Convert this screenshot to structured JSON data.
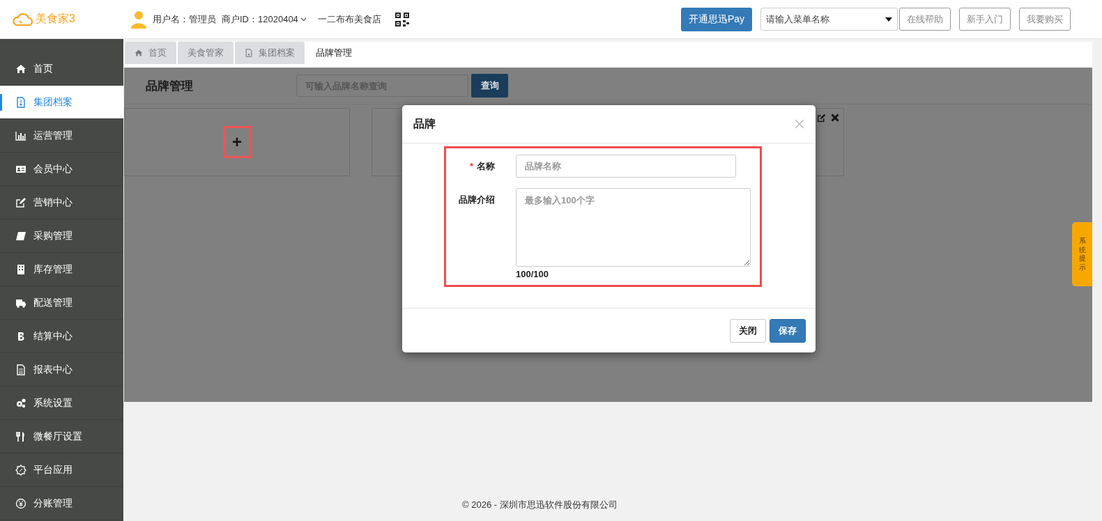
{
  "header": {
    "logo_text": "美食家3",
    "user": "用户名：管理员",
    "merchant": "商户ID：12020404",
    "store": "一二布布美食店",
    "pay_button": "开通思迅Pay",
    "menu_search": {
      "placeholder": "请输入菜单名称"
    },
    "buttons": [
      "在线帮助",
      "新手入门",
      "我要购买"
    ]
  },
  "sidebar": {
    "items": [
      {
        "label": "首页",
        "selected": false
      },
      {
        "label": "集团档案",
        "selected": true
      },
      {
        "label": "运营管理",
        "selected": false
      },
      {
        "label": "会员中心",
        "selected": false
      },
      {
        "label": "营销中心",
        "selected": false
      },
      {
        "label": "采购管理",
        "selected": false
      },
      {
        "label": "库存管理",
        "selected": false
      },
      {
        "label": "配送管理",
        "selected": false
      },
      {
        "label": "结算中心",
        "selected": false
      },
      {
        "label": "报表中心",
        "selected": false
      },
      {
        "label": "系统设置",
        "selected": false
      },
      {
        "label": "微餐厅设置",
        "selected": false
      },
      {
        "label": "平台应用",
        "selected": false
      },
      {
        "label": "分账管理",
        "selected": false
      }
    ]
  },
  "tabs": [
    {
      "label": "首页",
      "selected": false
    },
    {
      "label": "美食管家",
      "selected": false
    },
    {
      "label": "集团档案",
      "selected": false
    },
    {
      "label": "品牌管理",
      "selected": true
    }
  ],
  "page": {
    "title": "品牌管理",
    "search": {
      "placeholder": "可输入品牌名称查询"
    },
    "search_button": "查询",
    "add_card": "+"
  },
  "modal": {
    "title": "品牌",
    "fields": [
      {
        "kind": "input",
        "required_mark": "*",
        "label": "名称",
        "placeholder": "品牌名称"
      },
      {
        "kind": "textarea",
        "label": "品牌介绍",
        "placeholder": "最多输入100个字",
        "counter": "100/100"
      }
    ],
    "buttons": [
      {
        "kind": "default",
        "label": "关闭"
      },
      {
        "kind": "primary",
        "label": "保存"
      }
    ]
  },
  "notice_tab": "系统提示",
  "footer": "© 2026 - 深圳市思迅软件股份有限公司"
}
